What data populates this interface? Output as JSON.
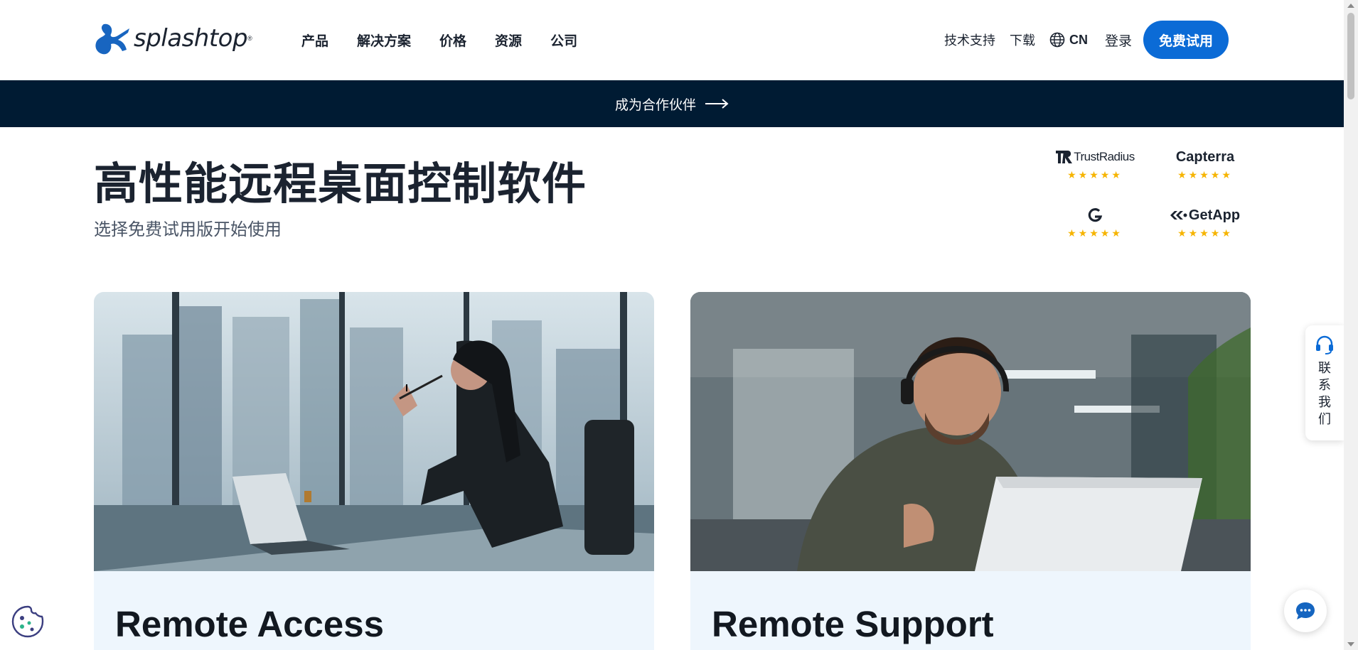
{
  "header": {
    "logo_text": "splashtop",
    "nav": [
      "产品",
      "解决方案",
      "价格",
      "资源",
      "公司"
    ],
    "support": "技术支持",
    "download": "下载",
    "language": "CN",
    "login": "登录",
    "trial_button": "免费试用"
  },
  "banner": {
    "link_text": "成为合作伙伴"
  },
  "hero": {
    "title": "高性能远程桌面控制软件",
    "subtitle": "选择免费试用版开始使用"
  },
  "ratings": [
    {
      "name": "TrustRadius",
      "stars": "★★★★★"
    },
    {
      "name": "Capterra",
      "stars": "★★★★★"
    },
    {
      "name": "G2",
      "stars": "★★★★★"
    },
    {
      "name": "GetApp",
      "stars": "★★★★★"
    }
  ],
  "cards": [
    {
      "title": "Remote Access"
    },
    {
      "title": "Remote Support"
    }
  ],
  "side_contact": {
    "label": "联系我们"
  },
  "colors": {
    "brand_blue": "#0b6bd6",
    "banner_navy": "#001b33",
    "star_gold": "#f6b400",
    "card_bg": "#eef6fd"
  }
}
